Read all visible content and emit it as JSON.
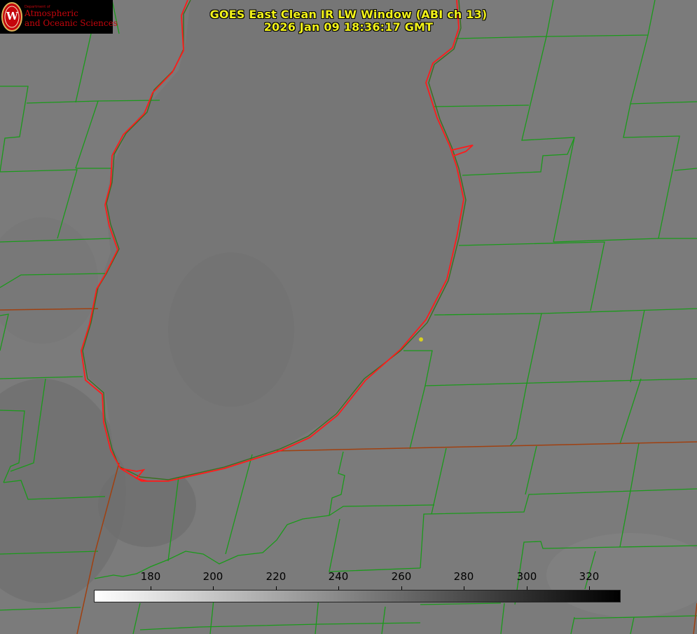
{
  "title": {
    "line1": "GOES East Clean IR LW Window (ABI ch 13)",
    "line2": "2026 Jan 09 18:36:17 GMT"
  },
  "logo": {
    "dept_label": "Department of",
    "line1": "Atmospheric",
    "line2": "and Oceanic Sciences",
    "seal_letter": "W"
  },
  "colorbar": {
    "ticks": [
      "180",
      "200",
      "220",
      "240",
      "260",
      "280",
      "300",
      "320"
    ],
    "gradient": [
      "#ffffff",
      "#000000"
    ]
  },
  "colors": {
    "background": "#7b7b7b",
    "lake": "#767676",
    "county_lines": "#1a9a1a",
    "state_lines": "#a04010",
    "coastline_red": "#ff1a1a",
    "title_text": "#f2f21a",
    "marker": "#d8d020"
  }
}
